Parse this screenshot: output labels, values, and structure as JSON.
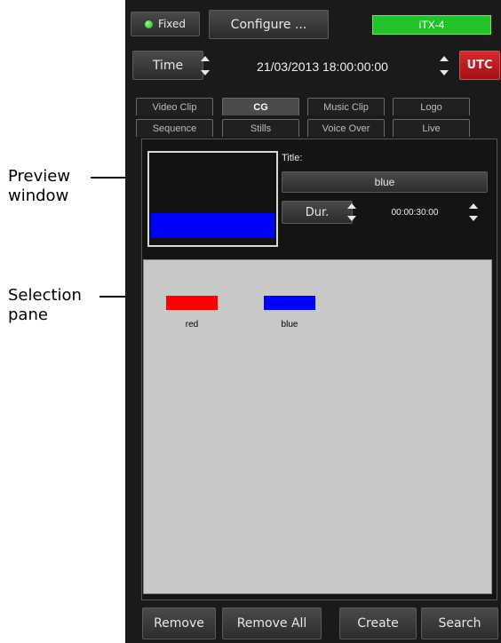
{
  "callouts": {
    "preview_line1": "Preview",
    "preview_line2": "window",
    "selection_line1": "Selection",
    "selection_line2": "pane"
  },
  "top_bar": {
    "fixed_label": "Fixed",
    "configure_label": "Configure ...",
    "channel_name": "iTX-4"
  },
  "time_bar": {
    "time_label": "Time",
    "datetime_value": "21/03/2013 18:00:00:00",
    "utc_label": "UTC"
  },
  "tabs": {
    "row1": [
      "Video Clip",
      "CG",
      "Music Clip",
      "Logo"
    ],
    "row2": [
      "Sequence",
      "Stills",
      "Voice Over",
      "Live"
    ],
    "active": "CG"
  },
  "properties": {
    "title_label": "Title:",
    "title_value": "blue",
    "duration_label": "Dur.",
    "duration_value": "00:00:30:00"
  },
  "selection_items": [
    {
      "label": "red",
      "color": "#ff0000"
    },
    {
      "label": "blue",
      "color": "#0000ff"
    }
  ],
  "bottom_buttons": {
    "remove": "Remove",
    "remove_all": "Remove All",
    "create": "Create",
    "search": "Search"
  },
  "colors": {
    "status_green": "#22c32a",
    "utc_red": "#c0161b",
    "preview_blue": "#0000ff",
    "selection_bg": "#c8c8c8"
  }
}
